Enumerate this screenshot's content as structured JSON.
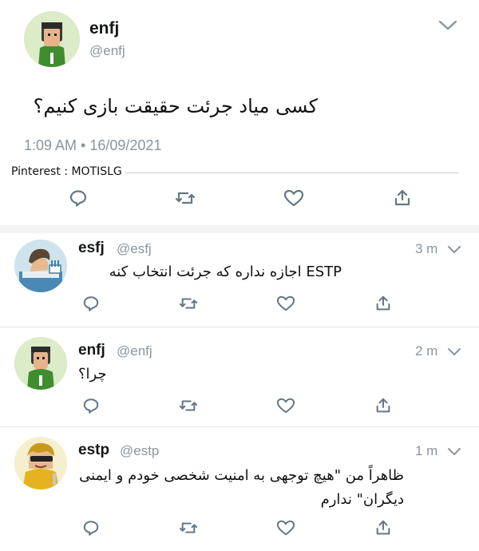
{
  "main_tweet": {
    "display_name": "enfj",
    "handle": "@enfj",
    "text": "کسی میاد جرئت حقیقت بازی کنیم؟",
    "timestamp": "1:09 AM • 16/09/2021",
    "watermark": "Pinterest : MOTISLG"
  },
  "replies": [
    {
      "display_name": "esfj",
      "handle": "@esfj",
      "time": "3 m",
      "text": "ESTP اجازه نداره که جرئت انتخاب کنه"
    },
    {
      "display_name": "enfj",
      "handle": "@enfj",
      "time": "2 m",
      "text": "چرا؟"
    },
    {
      "display_name": "estp",
      "handle": "@estp",
      "time": "1 m",
      "text": "ظاهراً من \"هیچ توجهی به امنیت شخصی خودم و ایمنی دیگران\" ندارم"
    }
  ],
  "icons": [
    "reply-icon",
    "retweet-icon",
    "like-icon",
    "share-icon",
    "chevron-down-icon"
  ],
  "colors": {
    "icon": "#657786",
    "secondary_text": "#8a959e",
    "divider": "#e1e6ea",
    "band": "#f3f3f3"
  }
}
